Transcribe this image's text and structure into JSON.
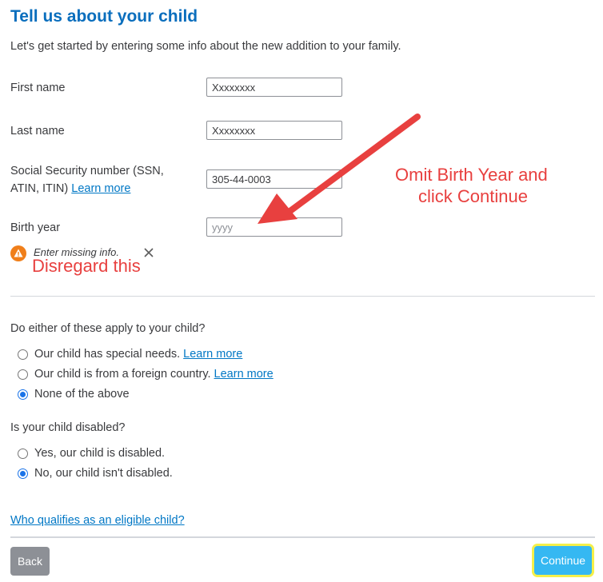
{
  "header": {
    "title": "Tell us about your child",
    "intro": "Let's get started by entering some info about the new addition to your family."
  },
  "form": {
    "first_name_label": "First name",
    "first_name_value": "Xxxxxxxx",
    "last_name_label": "Last name",
    "last_name_value": "Xxxxxxxx",
    "ssn_label_line1": "Social Security number (SSN,",
    "ssn_label_line2": "ATIN, ITIN)",
    "ssn_learn_more": "Learn more",
    "ssn_value": "305-44-0003",
    "birth_year_label": "Birth year",
    "birth_year_placeholder": "yyyy",
    "birth_year_value": "",
    "error_text": "Enter missing info."
  },
  "question1": {
    "text": "Do either of these apply to your child?",
    "options": [
      {
        "label": "Our child has special needs.",
        "link": "Learn more",
        "selected": false
      },
      {
        "label": "Our child is from a foreign country.",
        "link": "Learn more",
        "selected": false
      },
      {
        "label": "None of the above",
        "selected": true
      }
    ]
  },
  "question2": {
    "text": "Is your child disabled?",
    "options": [
      {
        "label": "Yes, our child is disabled.",
        "selected": false
      },
      {
        "label": "No, our child isn't disabled.",
        "selected": true
      }
    ]
  },
  "footer": {
    "eligible_link": "Who qualifies as an eligible child?",
    "back_label": "Back",
    "continue_label": "Continue"
  },
  "annotations": {
    "instruction_line1": "Omit Birth Year and",
    "instruction_line2": "click Continue",
    "disregard": "Disregard this"
  },
  "colors": {
    "title": "#0a6ebd",
    "link": "#0077c5",
    "annotation": "#e8403f",
    "continue_button": "#35b8f2",
    "continue_highlight": "#f5f04a",
    "back_button": "#8d9096",
    "warning": "#f07f1a"
  }
}
